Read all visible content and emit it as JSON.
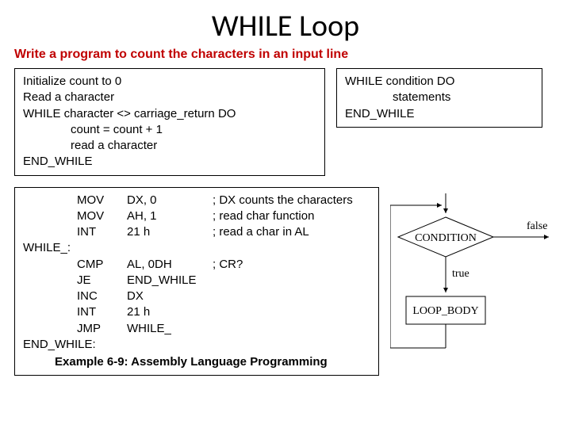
{
  "title": "WHILE Loop",
  "subtitle": "Write a program to count the characters in an input line",
  "pseudo": {
    "l1": "Initialize count to 0",
    "l2": "Read a character",
    "l3": "WHILE character <> carriage_return DO",
    "l4": "count = count + 1",
    "l5": "read a character",
    "l6": "END_WHILE"
  },
  "syntax": {
    "l1": "WHILE condition DO",
    "l2": "statements",
    "l3": "END_WHILE"
  },
  "asm": {
    "rows": [
      {
        "label": "",
        "mn": "MOV",
        "op": "DX, 0",
        "cm": "; DX counts the characters"
      },
      {
        "label": "",
        "mn": "MOV",
        "op": "AH, 1",
        "cm": "; read char function"
      },
      {
        "label": "",
        "mn": "INT",
        "op": "21 h",
        "cm": "; read a char in AL"
      },
      {
        "label": "WHILE_:",
        "mn": "",
        "op": "",
        "cm": ""
      },
      {
        "label": "",
        "mn": "CMP",
        "op": "AL, 0DH",
        "cm": "; CR?"
      },
      {
        "label": "",
        "mn": "JE",
        "op": "END_WHILE",
        "cm": ""
      },
      {
        "label": "",
        "mn": "INC",
        "op": "DX",
        "cm": ""
      },
      {
        "label": "",
        "mn": "INT",
        "op": "21 h",
        "cm": ""
      },
      {
        "label": "",
        "mn": "JMP",
        "op": "WHILE_",
        "cm": ""
      },
      {
        "label": "END_WHILE:",
        "mn": "",
        "op": "",
        "cm": ""
      }
    ],
    "caption": "Example 6-9: Assembly Language Programming"
  },
  "flow": {
    "condition": "CONDITION",
    "body": "LOOP_BODY",
    "t": "true",
    "f": "false"
  }
}
